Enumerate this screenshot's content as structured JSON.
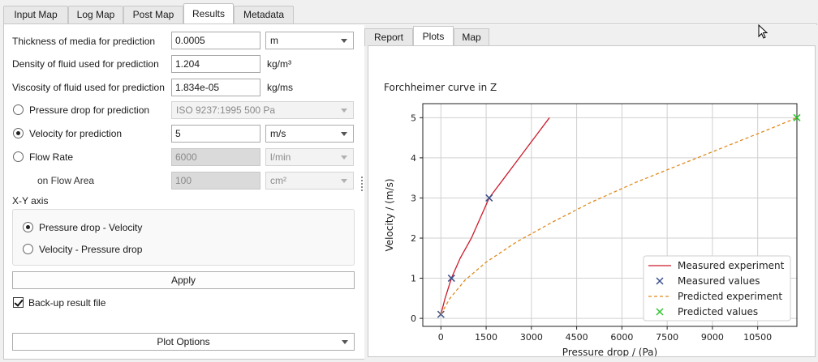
{
  "top_tabs": [
    "Input Map",
    "Log Map",
    "Post Map",
    "Results",
    "Metadata"
  ],
  "form": {
    "thickness": {
      "label": "Thickness of media for prediction",
      "value": "0.0005",
      "unit": "m"
    },
    "density": {
      "label": "Density of fluid used for prediction",
      "value": "1.204",
      "unit": "kg/m³"
    },
    "viscosity": {
      "label": "Viscosity of fluid used for prediction",
      "value": "1.834e-05",
      "unit": "kg/ms"
    },
    "pressure_drop": {
      "label": "Pressure drop for prediction",
      "value": "ISO 9237:1995 500 Pa"
    },
    "velocity": {
      "label": "Velocity for prediction",
      "value": "5",
      "unit": "m/s"
    },
    "flow_rate": {
      "label": "Flow Rate",
      "value": "6000",
      "unit": "l/min"
    },
    "flow_area": {
      "label": "on Flow Area",
      "value": "100",
      "unit": "cm²"
    }
  },
  "xy_axis": {
    "title": "X-Y axis",
    "option1": "Pressure drop - Velocity",
    "option2": "Velocity - Pressure drop"
  },
  "apply_label": "Apply",
  "backup_label": "Back-up result file",
  "plot_options_label": "Plot Options",
  "result_tabs": [
    "Report",
    "Plots",
    "Map"
  ],
  "colors": {
    "measured_line": "#cc1b2b",
    "measured_marker": "#3a4f8a",
    "predicted_line": "#e08a1e",
    "predicted_marker": "#2ec42e"
  },
  "chart_data": {
    "type": "line",
    "title": "Forchheimer curve in Z",
    "xlabel": "Pressure drop / (Pa)",
    "ylabel": "Velocity / (m/s)",
    "xlim": [
      -600,
      11800
    ],
    "ylim": [
      -0.2,
      5.35
    ],
    "xticks": [
      0,
      1500,
      3000,
      4500,
      6000,
      7500,
      9000,
      10500
    ],
    "yticks": [
      0,
      1,
      2,
      3,
      4,
      5
    ],
    "grid": true,
    "legend_position": "bottom-right",
    "series": [
      {
        "name": "Measured experiment",
        "kind": "line",
        "style": "solid",
        "x": [
          0,
          140,
          350,
          640,
          1010,
          1600,
          2100,
          2700,
          3150,
          3600
        ],
        "y": [
          0.1,
          0.5,
          1.0,
          1.5,
          2.0,
          3.0,
          3.5,
          4.1,
          4.55,
          5.0
        ]
      },
      {
        "name": "Measured values",
        "kind": "marker",
        "marker": "x",
        "x": [
          0,
          350,
          1600
        ],
        "y": [
          0.1,
          1.0,
          3.0
        ]
      },
      {
        "name": "Predicted experiment",
        "kind": "line",
        "style": "dashed",
        "x": [
          0,
          300,
          800,
          1500,
          2500,
          3700,
          5000,
          6500,
          8000,
          9500,
          11000,
          11800
        ],
        "y": [
          0.1,
          0.5,
          0.95,
          1.4,
          1.9,
          2.4,
          2.9,
          3.4,
          3.85,
          4.3,
          4.75,
          5.0
        ]
      },
      {
        "name": "Predicted values",
        "kind": "marker",
        "marker": "x",
        "x": [
          11800
        ],
        "y": [
          5.0
        ]
      }
    ]
  }
}
